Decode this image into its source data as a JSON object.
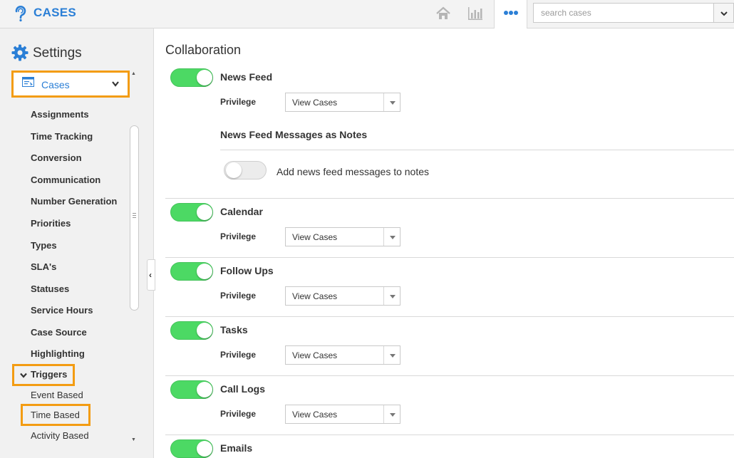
{
  "app": {
    "title": "CASES",
    "brand_color": "#2b7fd6"
  },
  "header": {
    "icons": [
      "home-icon",
      "bar-chart-icon",
      "more-icon"
    ],
    "search": {
      "placeholder": "search cases",
      "value": ""
    }
  },
  "sidebar": {
    "title": "Settings",
    "module": "Cases",
    "items": [
      "Assignments",
      "Time Tracking",
      "Conversion",
      "Communication",
      "Number Generation",
      "Priorities",
      "Types",
      "SLA's",
      "Statuses",
      "Service Hours",
      "Case Source",
      "Highlighting"
    ],
    "triggers": {
      "label": "Triggers",
      "expanded": true,
      "items": [
        "Event Based",
        "Time Based",
        "Activity Based"
      ],
      "selected": "Time Based"
    },
    "highlight_color": "#f39c12"
  },
  "main": {
    "title": "Collaboration",
    "privilege_label": "Privilege",
    "sections": [
      {
        "title": "News Feed",
        "enabled": true,
        "privilege": "View Cases",
        "sub": {
          "title": "News Feed Messages as Notes",
          "toggle_label": "Add news feed messages to notes",
          "enabled": false
        }
      },
      {
        "title": "Calendar",
        "enabled": true,
        "privilege": "View Cases"
      },
      {
        "title": "Follow Ups",
        "enabled": true,
        "privilege": "View Cases"
      },
      {
        "title": "Tasks",
        "enabled": true,
        "privilege": "View Cases"
      },
      {
        "title": "Call Logs",
        "enabled": true,
        "privilege": "View Cases"
      },
      {
        "title": "Emails",
        "enabled": true
      }
    ],
    "toggle_on_color": "#4cd964"
  }
}
